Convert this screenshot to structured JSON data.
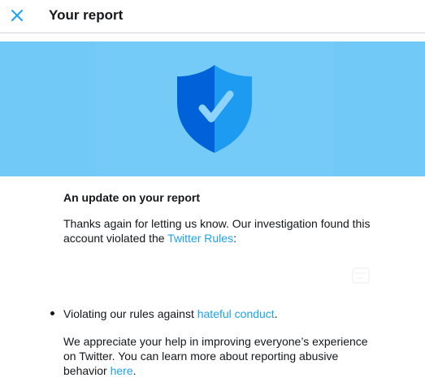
{
  "header": {
    "title": "Your report",
    "close_icon": "close-icon"
  },
  "banner": {
    "icon": "shield-check-icon",
    "colors": {
      "background": "#71c9f8",
      "shield_dark": "#0061d9",
      "shield_light": "#1d9bf0",
      "check": "#8fd3ff"
    }
  },
  "report": {
    "heading": "An update on your report",
    "intro_text": "Thanks again for letting us know. Our investigation found this account violated the ",
    "rules_link": "Twitter Rules",
    "intro_suffix": ":",
    "bullet_prefix": "Violating our rules against ",
    "bullet_link": "hateful conduct",
    "bullet_suffix": ".",
    "closing_text": "We appreciate your help in improving everyone’s experience on Twitter. You can learn more about reporting abusive behavior ",
    "closing_link": "here",
    "closing_suffix": "."
  },
  "colors": {
    "link": "#1da1f2",
    "text": "#14171a",
    "divider": "#cfd4d8"
  }
}
